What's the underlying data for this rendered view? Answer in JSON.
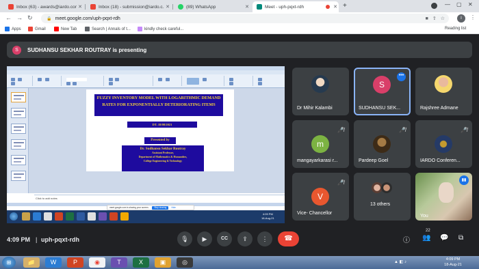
{
  "browser": {
    "tabs": [
      {
        "title": "Inbox (63) - awards@iardo.com",
        "fav_color": "#ea4335",
        "active": false
      },
      {
        "title": "Inbox (18) - submission@iardo.c...",
        "fav_color": "#ea4335",
        "active": false
      },
      {
        "title": "(89) WhatsApp",
        "fav_color": "#25d366",
        "active": false
      },
      {
        "title": "Meet - uph-pqxt-rdh",
        "fav_color": "#00897b",
        "active": true
      }
    ],
    "new_tab": "+",
    "url": "meet.google.com/uph-pqxt-rdh",
    "profile_initial": "I",
    "bookmarks": [
      {
        "label": "Apps",
        "color": "#1a73e8"
      },
      {
        "label": "Gmail",
        "color": "#ea4335"
      },
      {
        "label": "New Tab",
        "color": "#ff0000"
      },
      {
        "label": "Search | Annals of t...",
        "color": "#5f6368"
      },
      {
        "label": "kindly check careful...",
        "color": "#c58af9"
      }
    ],
    "reading_list": "Reading list"
  },
  "meet": {
    "presenter_initial": "S",
    "presenting_text": "SUDHANSU SEKHAR ROUTRAY is presenting",
    "slide": {
      "title": "FUZZY INVENTORY MODEL WITH LOGARITHMIC DEMAND RATES FOR EXPONENTIALLY DETERIORATING ITEMS",
      "date": "DT. 18/08/2021",
      "presented_by": "Presented by",
      "presenter_name": "Dr. Sudhansu Sekhar Routray",
      "role": "Assistant Professor,",
      "dept": "Department of Mathematics & Humanities,",
      "college": "College Engineering & Technology"
    },
    "notes_placeholder": "Click to add notes",
    "share_text": "meet.google.com is sharing your screen.",
    "stop_sharing": "Stop sharing",
    "hide": "Hide",
    "inner_clock": "4:09 PM\n18-Aug-21",
    "participants": [
      {
        "name": "Dr Mihir Kalambi",
        "kind": "photo",
        "color": "#5b6e7d"
      },
      {
        "name": "SUDHANSU SEK...",
        "kind": "avatar",
        "initial": "S",
        "color": "#d93f69",
        "highlight": true
      },
      {
        "name": "Rajshree Admane",
        "kind": "photo",
        "color": "#e3a88e"
      },
      {
        "name": "mangayarkarasi r...",
        "kind": "avatar",
        "initial": "m",
        "color": "#7cb342",
        "muted": true
      },
      {
        "name": "Pardeep Goel",
        "kind": "photo",
        "color": "#8a6d3b",
        "muted": true
      },
      {
        "name": "IARDO Conferen...",
        "kind": "photo",
        "color": "#3b4f7a",
        "muted": true
      },
      {
        "name": "Vice- Chancellor",
        "kind": "avatar",
        "initial": "V",
        "color": "#e8572f",
        "muted": true
      },
      {
        "name": "13 others",
        "kind": "group"
      },
      {
        "name": "You",
        "kind": "video"
      }
    ],
    "time": "4:09 PM",
    "separator": "|",
    "meeting_code": "uph-pqxt-rdh",
    "participant_count": "22",
    "controls": {
      "mic": "🎙",
      "camera": "▶",
      "captions": "CC",
      "present": "⇪",
      "more": "⋮",
      "end": "☎"
    }
  },
  "os": {
    "clock_time": "4:09 PM",
    "clock_date": "18-Aug-21",
    "tray": "▲ ◧ ♪"
  }
}
